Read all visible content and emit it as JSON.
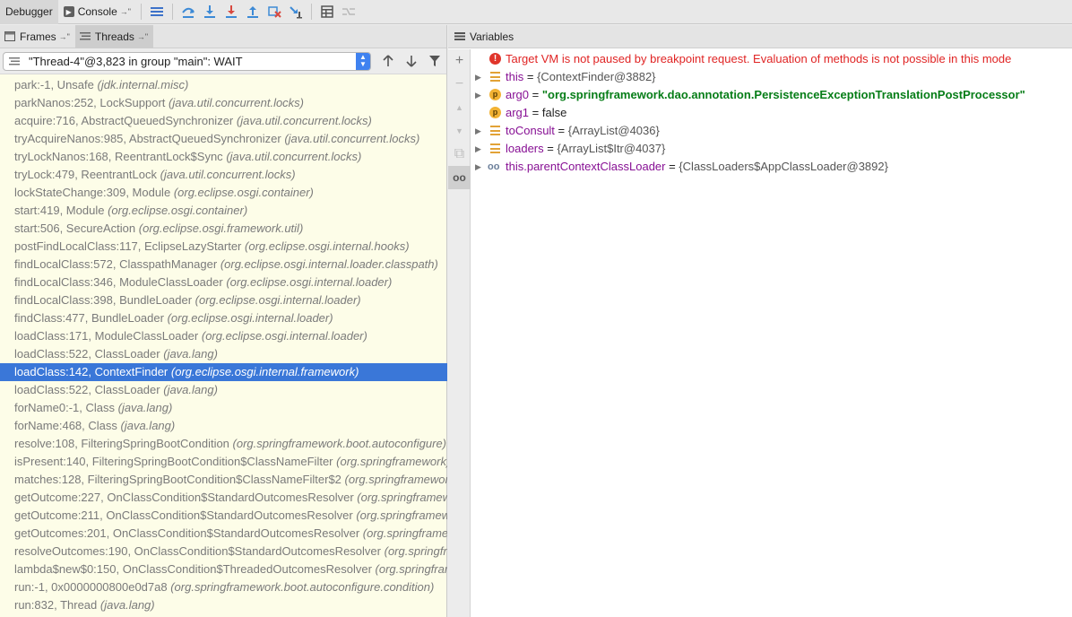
{
  "toolbar": {
    "debugger_label": "Debugger",
    "console_label": "Console",
    "pin_glyph": "→\"",
    "buttons": [
      {
        "icon": "show-execution-point-icon"
      },
      {
        "icon": "step-over-icon"
      },
      {
        "icon": "step-into-icon"
      },
      {
        "icon": "force-step-into-icon"
      },
      {
        "icon": "step-out-icon"
      },
      {
        "icon": "drop-frame-icon"
      },
      {
        "icon": "run-to-cursor-icon"
      },
      {
        "icon": "evaluate-expression-icon"
      },
      {
        "icon": "trace-current-stream-icon"
      }
    ]
  },
  "left_panel": {
    "tabs": [
      {
        "label": "Frames",
        "active": false
      },
      {
        "label": "Threads",
        "active": true
      }
    ],
    "thread_selector": {
      "value": "\"Thread-4\"@3,823 in group \"main\": WAIT"
    },
    "frames": [
      {
        "method": "park:-1, Unsafe",
        "package": "(jdk.internal.misc)"
      },
      {
        "method": "parkNanos:252, LockSupport",
        "package": "(java.util.concurrent.locks)"
      },
      {
        "method": "acquire:716, AbstractQueuedSynchronizer",
        "package": "(java.util.concurrent.locks)"
      },
      {
        "method": "tryAcquireNanos:985, AbstractQueuedSynchronizer",
        "package": "(java.util.concurrent.locks)"
      },
      {
        "method": "tryLockNanos:168, ReentrantLock$Sync",
        "package": "(java.util.concurrent.locks)"
      },
      {
        "method": "tryLock:479, ReentrantLock",
        "package": "(java.util.concurrent.locks)"
      },
      {
        "method": "lockStateChange:309, Module",
        "package": "(org.eclipse.osgi.container)"
      },
      {
        "method": "start:419, Module",
        "package": "(org.eclipse.osgi.container)"
      },
      {
        "method": "start:506, SecureAction",
        "package": "(org.eclipse.osgi.framework.util)"
      },
      {
        "method": "postFindLocalClass:117, EclipseLazyStarter",
        "package": "(org.eclipse.osgi.internal.hooks)"
      },
      {
        "method": "findLocalClass:572, ClasspathManager",
        "package": "(org.eclipse.osgi.internal.loader.classpath)"
      },
      {
        "method": "findLocalClass:346, ModuleClassLoader",
        "package": "(org.eclipse.osgi.internal.loader)"
      },
      {
        "method": "findLocalClass:398, BundleLoader",
        "package": "(org.eclipse.osgi.internal.loader)"
      },
      {
        "method": "findClass:477, BundleLoader",
        "package": "(org.eclipse.osgi.internal.loader)"
      },
      {
        "method": "loadClass:171, ModuleClassLoader",
        "package": "(org.eclipse.osgi.internal.loader)"
      },
      {
        "method": "loadClass:522, ClassLoader",
        "package": "(java.lang)"
      },
      {
        "method": "loadClass:142, ContextFinder",
        "package": "(org.eclipse.osgi.internal.framework)",
        "selected": true
      },
      {
        "method": "loadClass:522, ClassLoader",
        "package": "(java.lang)"
      },
      {
        "method": "forName0:-1, Class",
        "package": "(java.lang)"
      },
      {
        "method": "forName:468, Class",
        "package": "(java.lang)"
      },
      {
        "method": "resolve:108, FilteringSpringBootCondition",
        "package": "(org.springframework.boot.autoconfigure)"
      },
      {
        "method": "isPresent:140, FilteringSpringBootCondition$ClassNameFilter",
        "package": "(org.springframework)"
      },
      {
        "method": "matches:128, FilteringSpringBootCondition$ClassNameFilter$2",
        "package": "(org.springframework)"
      },
      {
        "method": "getOutcome:227, OnClassCondition$StandardOutcomesResolver",
        "package": "(org.springframework)"
      },
      {
        "method": "getOutcome:211, OnClassCondition$StandardOutcomesResolver",
        "package": "(org.springframework)"
      },
      {
        "method": "getOutcomes:201, OnClassCondition$StandardOutcomesResolver",
        "package": "(org.springframework)"
      },
      {
        "method": "resolveOutcomes:190, OnClassCondition$StandardOutcomesResolver",
        "package": "(org.springframework)"
      },
      {
        "method": "lambda$new$0:150, OnClassCondition$ThreadedOutcomesResolver",
        "package": "(org.springframework)"
      },
      {
        "method": "run:-1, 0x0000000800e0d7a8",
        "package": "(org.springframework.boot.autoconfigure.condition)"
      },
      {
        "method": "run:832, Thread",
        "package": "(java.lang)"
      }
    ]
  },
  "right_panel": {
    "title": "Variables",
    "side_buttons": [
      {
        "icon": "add-icon",
        "glyph": "+"
      },
      {
        "icon": "remove-icon",
        "glyph": "−"
      },
      {
        "icon": "move-up-icon",
        "glyph": "▲"
      },
      {
        "icon": "move-down-icon",
        "glyph": "▼"
      },
      {
        "icon": "copy-icon",
        "glyph": "⧉"
      },
      {
        "icon": "show-watches-glasses-icon",
        "glyph": "oo"
      }
    ],
    "warning": "Target VM is not paused by breakpoint request. Evaluation of methods is not possible in this mode",
    "variables": [
      {
        "name": "this",
        "value": "{ContextFinder@3882}",
        "icon": "object-icon",
        "expandable": true
      },
      {
        "name": "arg0",
        "value": "\"org.springframework.dao.annotation.PersistenceExceptionTranslationPostProcessor\"",
        "icon": "parameter-icon",
        "expandable": true,
        "kind": "string"
      },
      {
        "name": "arg1",
        "value": "false",
        "icon": "parameter-icon",
        "expandable": false,
        "kind": "plain"
      },
      {
        "name": "toConsult",
        "value": "{ArrayList@4036}",
        "icon": "object-icon",
        "expandable": true
      },
      {
        "name": "loaders",
        "value": "{ArrayList$Itr@4037}",
        "icon": "object-icon",
        "expandable": true
      },
      {
        "name": "this.parentContextClassLoader",
        "value": "{ClassLoaders$AppClassLoader@3892}",
        "icon": "watch-glasses-icon",
        "expandable": true
      }
    ]
  },
  "colors": {
    "selection": "#3a77d8",
    "frames_bg": "#fdfde8",
    "error": "#e02424",
    "var_name": "#871094",
    "string_value": "#067d17"
  }
}
